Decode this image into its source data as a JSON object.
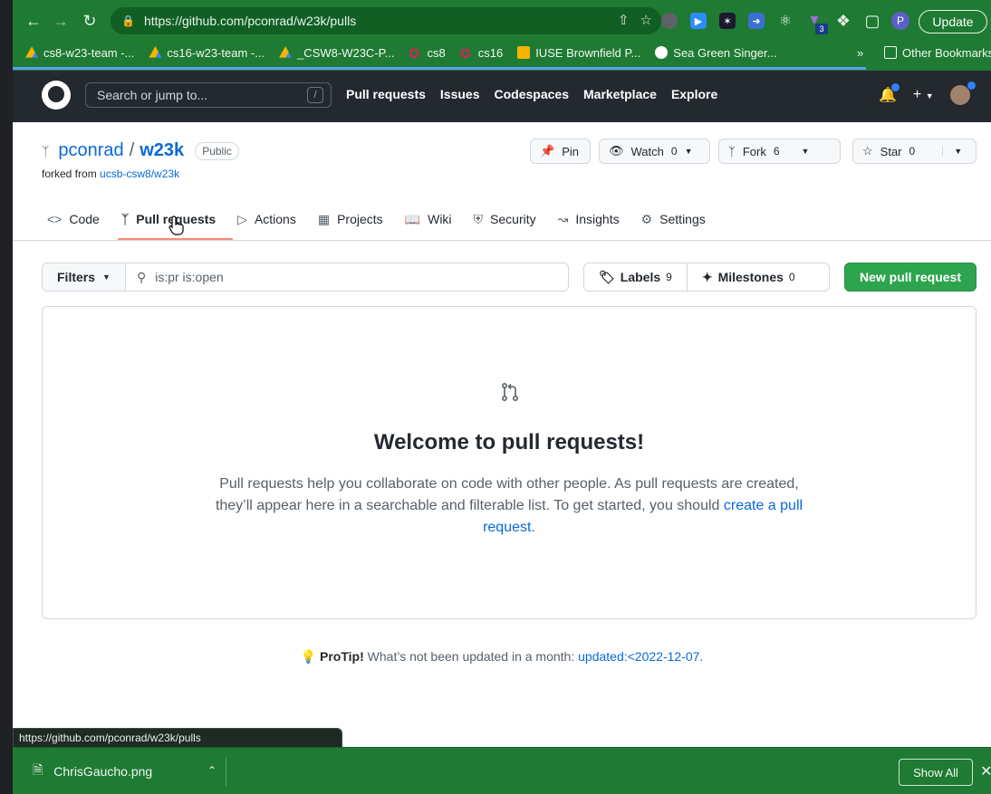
{
  "browser": {
    "url": "https://github.com/pconrad/w23k/pulls",
    "update_label": "Update",
    "profile_initial": "P",
    "ext_badge": "3",
    "bookmarks": [
      {
        "label": "cs8-w23-team -..."
      },
      {
        "label": "cs16-w23-team -..."
      },
      {
        "label": "_CSW8-W23C-P..."
      },
      {
        "label": "cs8"
      },
      {
        "label": "cs16"
      },
      {
        "label": "IUSE Brownfield P..."
      },
      {
        "label": "Sea Green Singer..."
      }
    ],
    "bookmarks_overflow": "»",
    "other_bookmarks": "Other Bookmarks",
    "status_url": "https://github.com/pconrad/w23k/pulls"
  },
  "github": {
    "search_placeholder": "Search or jump to...",
    "search_key": "/",
    "nav": [
      "Pull requests",
      "Issues",
      "Codespaces",
      "Marketplace",
      "Explore"
    ]
  },
  "repo": {
    "owner": "pconrad",
    "separator": "/",
    "name": "w23k",
    "visibility": "Public",
    "forked_prefix": "forked from",
    "forked_from": "ucsb-csw8/w23k",
    "pin_label": "Pin",
    "watch_label": "Watch",
    "watch_count": "0",
    "fork_label": "Fork",
    "fork_count": "6",
    "star_label": "Star",
    "star_count": "0"
  },
  "tabs": [
    {
      "label": "Code",
      "icon": "code-icon"
    },
    {
      "label": "Pull requests",
      "icon": "git-pull-request-icon",
      "active": true
    },
    {
      "label": "Actions",
      "icon": "play-icon"
    },
    {
      "label": "Projects",
      "icon": "table-icon"
    },
    {
      "label": "Wiki",
      "icon": "book-icon"
    },
    {
      "label": "Security",
      "icon": "shield-icon"
    },
    {
      "label": "Insights",
      "icon": "graph-icon"
    },
    {
      "label": "Settings",
      "icon": "gear-icon"
    }
  ],
  "toolbar": {
    "filters_label": "Filters",
    "search_value": "is:pr is:open",
    "labels_label": "Labels",
    "labels_count": "9",
    "milestones_label": "Milestones",
    "milestones_count": "0",
    "new_pr_label": "New pull request"
  },
  "blankslate": {
    "title": "Welcome to pull requests!",
    "desc": "Pull requests help you collaborate on code with other people. As pull requests are created, they’ll appear here in a searchable and filterable list. To get started, you should",
    "link": "create a pull request",
    "period": "."
  },
  "protip": {
    "label": "ProTip!",
    "text": "What’s not been updated in a month:",
    "link": "updated:<2022-12-07."
  },
  "downloads": {
    "file": "ChrisGaucho.png",
    "show_all": "Show All"
  },
  "colors": {
    "chrome_green": "#1f7a33",
    "github_dark": "#24292f",
    "link_blue": "#0969da",
    "primary_green": "#2da44e",
    "tab_underline": "#fd8c73"
  }
}
